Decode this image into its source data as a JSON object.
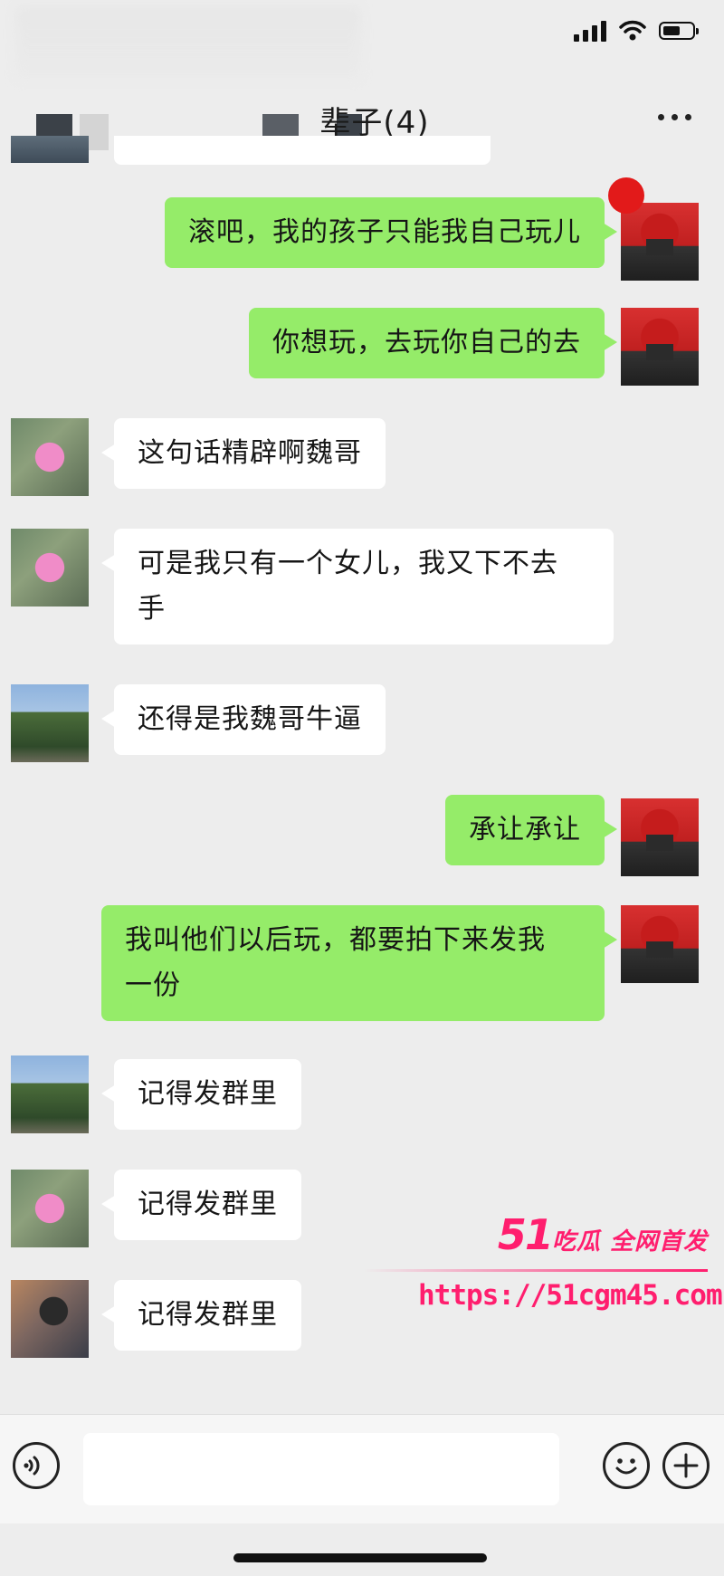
{
  "header": {
    "title": "辈子(4)"
  },
  "messages": [
    {
      "side": "out",
      "avatar": "self",
      "text": "滚吧，我的孩子只能我自己玩儿"
    },
    {
      "side": "out",
      "avatar": "self",
      "text": "你想玩，去玩你自己的去"
    },
    {
      "side": "in",
      "avatar": "pink-flower",
      "text": "这句话精辟啊魏哥"
    },
    {
      "side": "in",
      "avatar": "pink-flower",
      "text": "可是我只有一个女儿，我又下不去\n手"
    },
    {
      "side": "in",
      "avatar": "tree-sky",
      "text": "还得是我魏哥牛逼"
    },
    {
      "side": "out",
      "avatar": "self",
      "text": "承让承让"
    },
    {
      "side": "out",
      "avatar": "self",
      "text": "我叫他们以后玩，都要拍下来发我\n一份"
    },
    {
      "side": "in",
      "avatar": "tree-sky",
      "text": "记得发群里"
    },
    {
      "side": "in",
      "avatar": "pink-flower",
      "text": "记得发群里"
    },
    {
      "side": "in",
      "avatar": "person-sunset",
      "text": "记得发群里"
    }
  ],
  "watermark": {
    "brand_number": "51",
    "brand_text": "吃瓜 全网首发",
    "url": "https://51cgm45.com"
  },
  "input_bar": {
    "placeholder": "",
    "icons": [
      "voice-icon",
      "emoji-icon",
      "plus-icon"
    ]
  },
  "colors": {
    "background": "#ededed",
    "outgoing_bubble": "#95ec69",
    "incoming_bubble": "#ffffff",
    "watermark": "#ff1e6e"
  }
}
